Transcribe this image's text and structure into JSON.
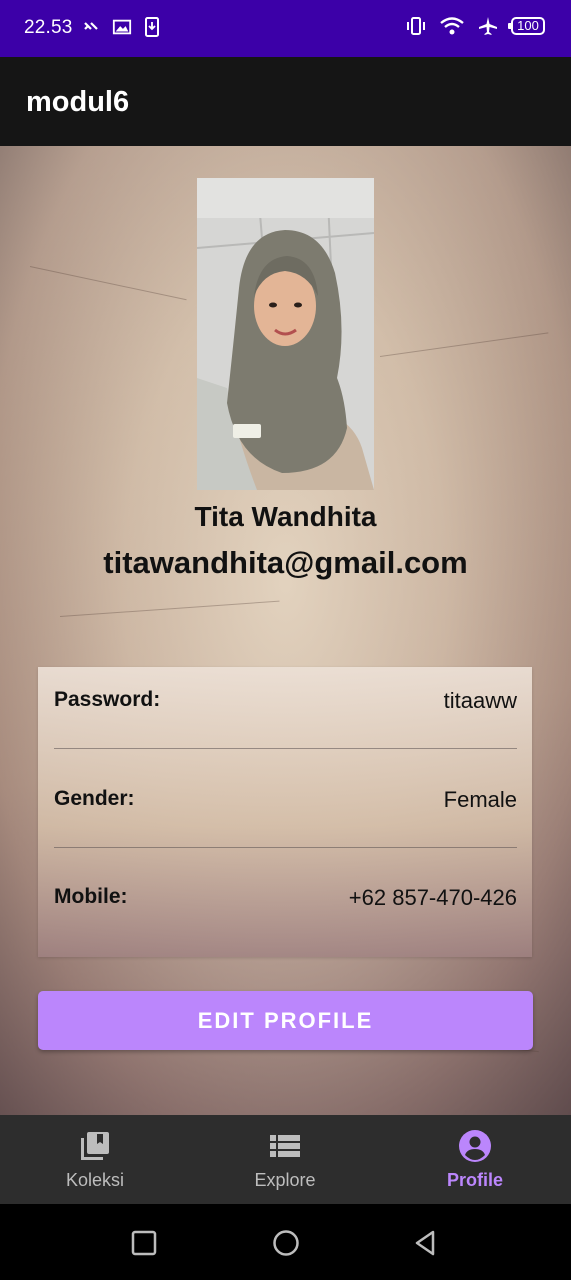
{
  "status_bar": {
    "time": "22.53",
    "battery": "100",
    "left_icons": [
      "link-icon",
      "image-icon",
      "download-icon"
    ],
    "right_icons": [
      "vibrate-icon",
      "wifi-icon",
      "airplane-icon",
      "battery-icon"
    ]
  },
  "app_bar": {
    "title": "modul6"
  },
  "profile": {
    "name": "Tita Wandhita",
    "email": "titawandhita@gmail.com"
  },
  "details": [
    {
      "label": "Password:",
      "value": "titaaww"
    },
    {
      "label": "Gender:",
      "value": "Female"
    },
    {
      "label": "Mobile:",
      "value": "+62 857-470-426"
    }
  ],
  "edit_button": {
    "label": "EDIT PROFILE"
  },
  "bottom_nav": {
    "items": [
      {
        "label": "Koleksi",
        "icon": "collection-icon",
        "active": false
      },
      {
        "label": "Explore",
        "icon": "list-icon",
        "active": false
      },
      {
        "label": "Profile",
        "icon": "account-circle-icon",
        "active": true
      }
    ]
  },
  "colors": {
    "status_bar": "#3c00a8",
    "app_bar": "#151515",
    "accent": "#bb86fc",
    "bottom_nav": "#2d2d2d"
  }
}
